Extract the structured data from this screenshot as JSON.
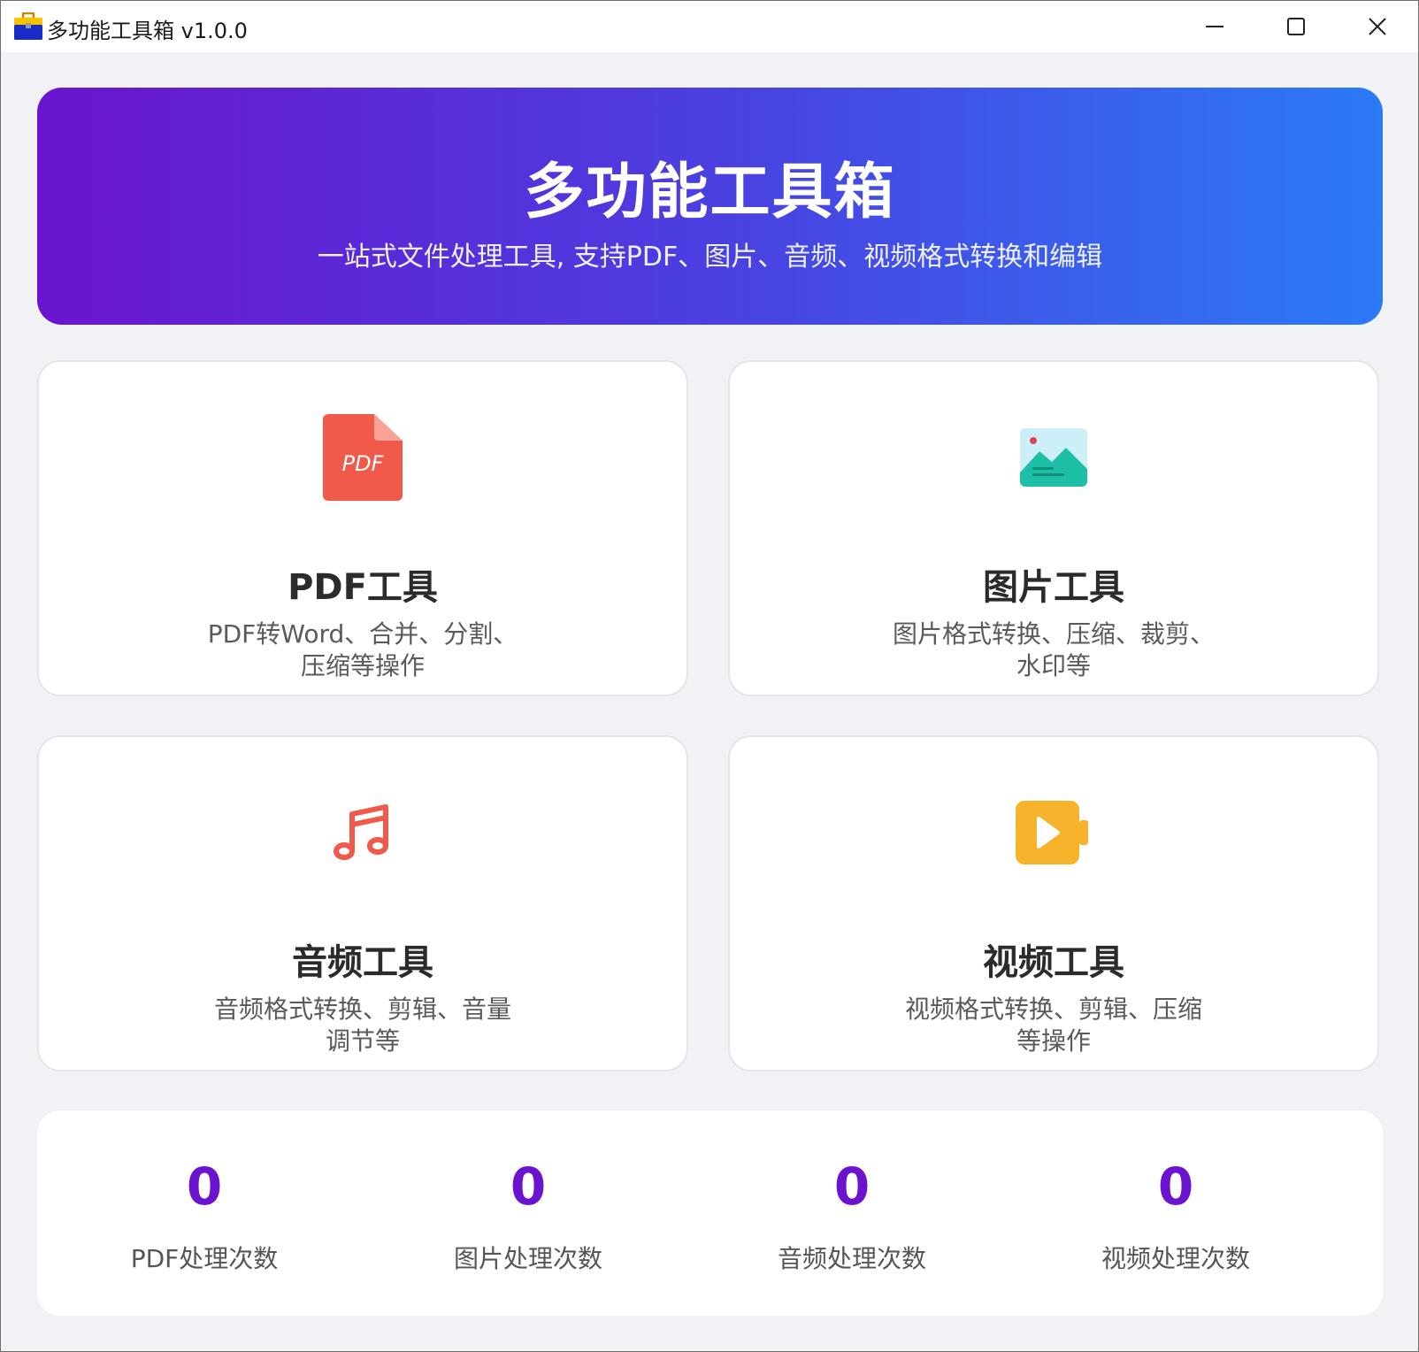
{
  "window": {
    "title": "多功能工具箱 v1.0.0",
    "icon": "toolbox-icon",
    "controls": [
      "minimize-icon",
      "maximize-icon",
      "close-icon"
    ]
  },
  "banner": {
    "title": "多功能工具箱",
    "subtitle": "一站式文件处理工具, 支持PDF、图片、音频、视频格式转换和编辑",
    "gradient": [
      "#6a14cf",
      "#2b7af7"
    ]
  },
  "cards": [
    {
      "icon": "pdf-file-icon",
      "title": "PDF工具",
      "desc_line1": "PDF转Word、合并、分割、",
      "desc_line2": "压缩等操作",
      "icon_text": "PDF",
      "color": "#f05a4a"
    },
    {
      "icon": "image-icon",
      "title": "图片工具",
      "desc_line1": "图片格式转换、压缩、裁剪、",
      "desc_line2": "水印等",
      "color": "#1dbfa6"
    },
    {
      "icon": "music-note-icon",
      "title": "音频工具",
      "desc_line1": "音频格式转换、剪辑、音量",
      "desc_line2": "调节等",
      "color": "#f05a4a"
    },
    {
      "icon": "video-camera-icon",
      "title": "视频工具",
      "desc_line1": "视频格式转换、剪辑、压缩",
      "desc_line2": "等操作",
      "color": "#f7b32b"
    }
  ],
  "stats": [
    {
      "value": "0",
      "label": "PDF处理次数"
    },
    {
      "value": "0",
      "label": "图片处理次数"
    },
    {
      "value": "0",
      "label": "音频处理次数"
    },
    {
      "value": "0",
      "label": "视频处理次数"
    }
  ],
  "colors": {
    "accent": "#6a14cf",
    "background": "#f0f2f5"
  }
}
